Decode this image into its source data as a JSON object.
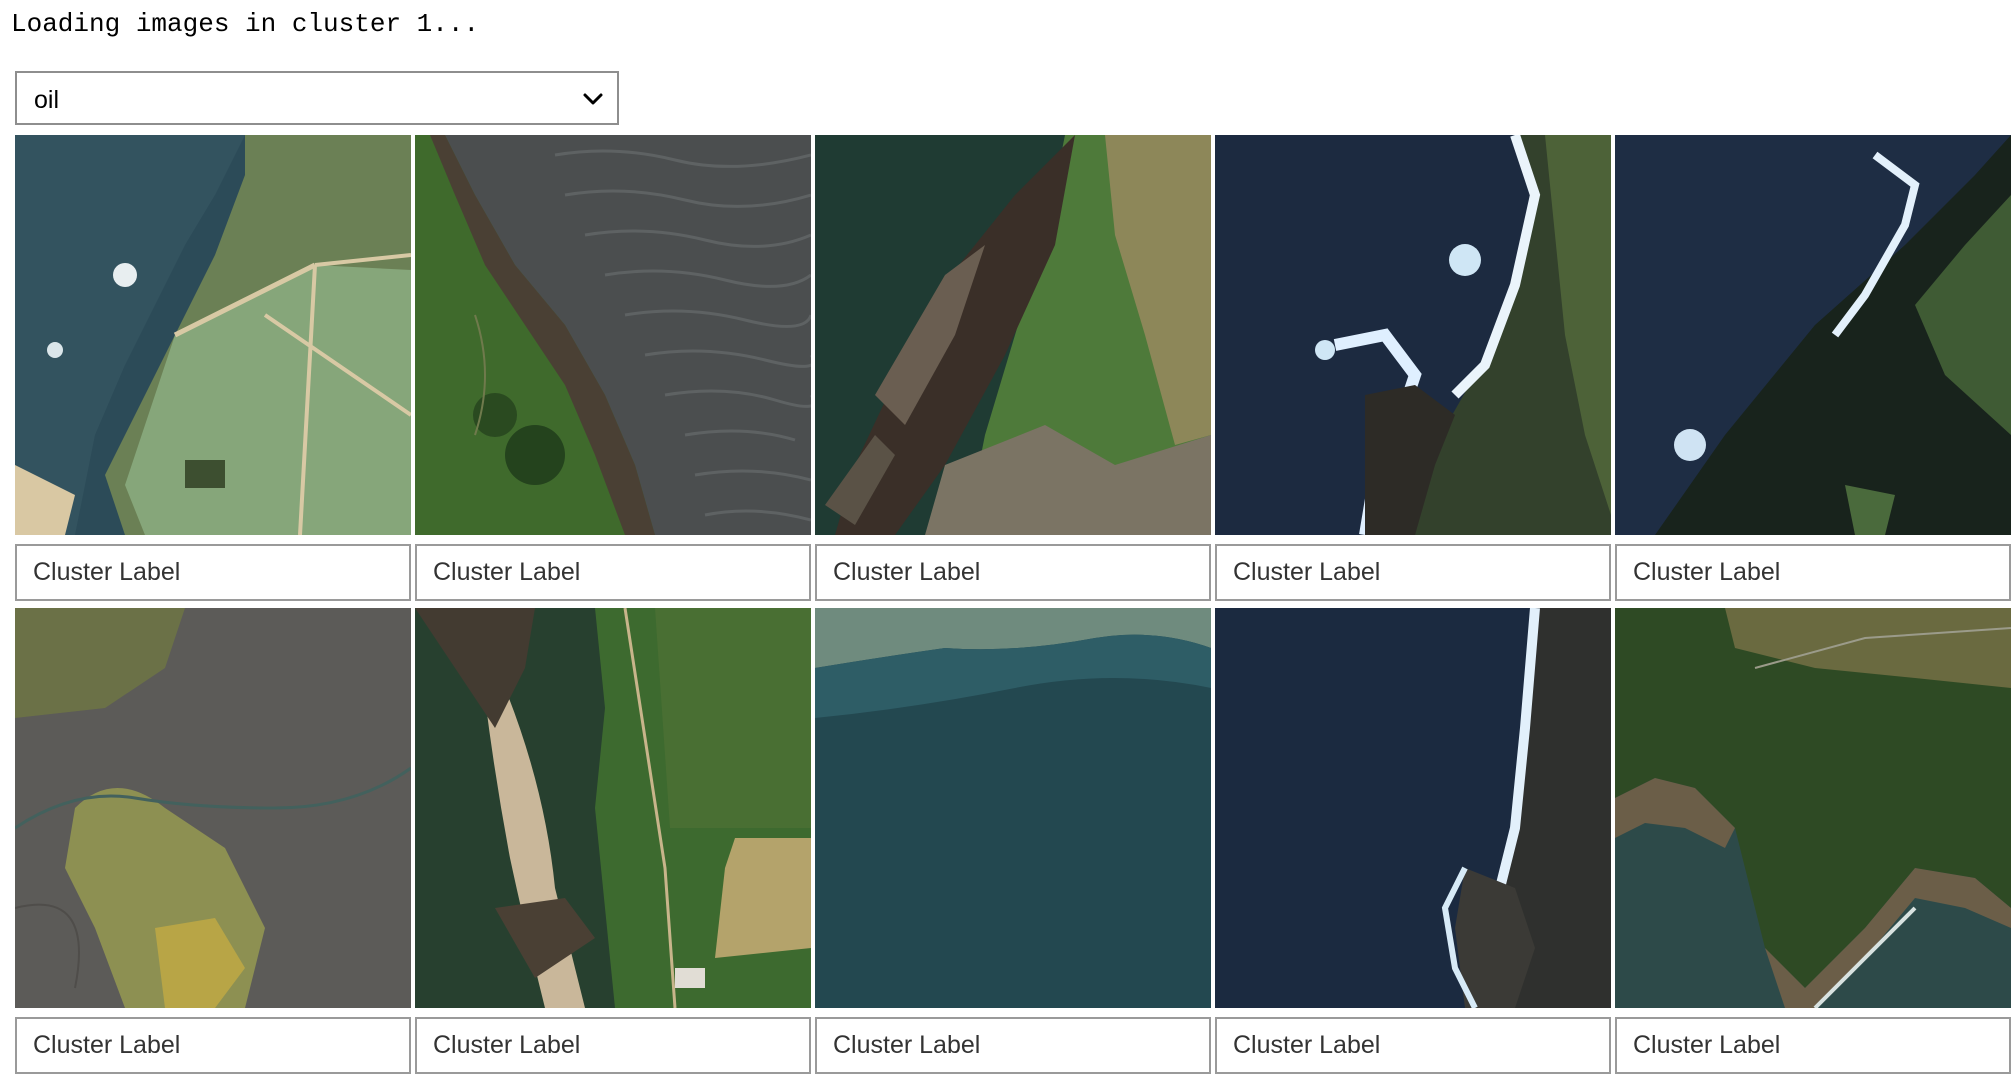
{
  "status": {
    "message": "Loading images in cluster 1..."
  },
  "cluster_select": {
    "selected": "oil",
    "icon": "chevron-down-icon"
  },
  "tiles": [
    {
      "scene": "coastline with green fields and road",
      "label_placeholder": "Cluster Label"
    },
    {
      "scene": "cliff edge and rippled grey sea",
      "label_placeholder": "Cluster Label"
    },
    {
      "scene": "rocky headland with green and brown fields",
      "label_placeholder": "Cluster Label"
    },
    {
      "scene": "dark sea with white surf on rocks",
      "label_placeholder": "Cluster Label"
    },
    {
      "scene": "dark sea with shaded cliff",
      "label_placeholder": "Cluster Label"
    },
    {
      "scene": "tidal mudflat with green islets",
      "label_placeholder": "Cluster Label"
    },
    {
      "scene": "sandy cove beside fields",
      "label_placeholder": "Cluster Label"
    },
    {
      "scene": "teal shallow water",
      "label_placeholder": "Cluster Label"
    },
    {
      "scene": "dark sea with surf along cliff",
      "label_placeholder": "Cluster Label"
    },
    {
      "scene": "green headland with surf",
      "label_placeholder": "Cluster Label"
    }
  ],
  "colors": {
    "border": "#8e8e8e",
    "text": "#000000",
    "placeholder": "#333333"
  }
}
